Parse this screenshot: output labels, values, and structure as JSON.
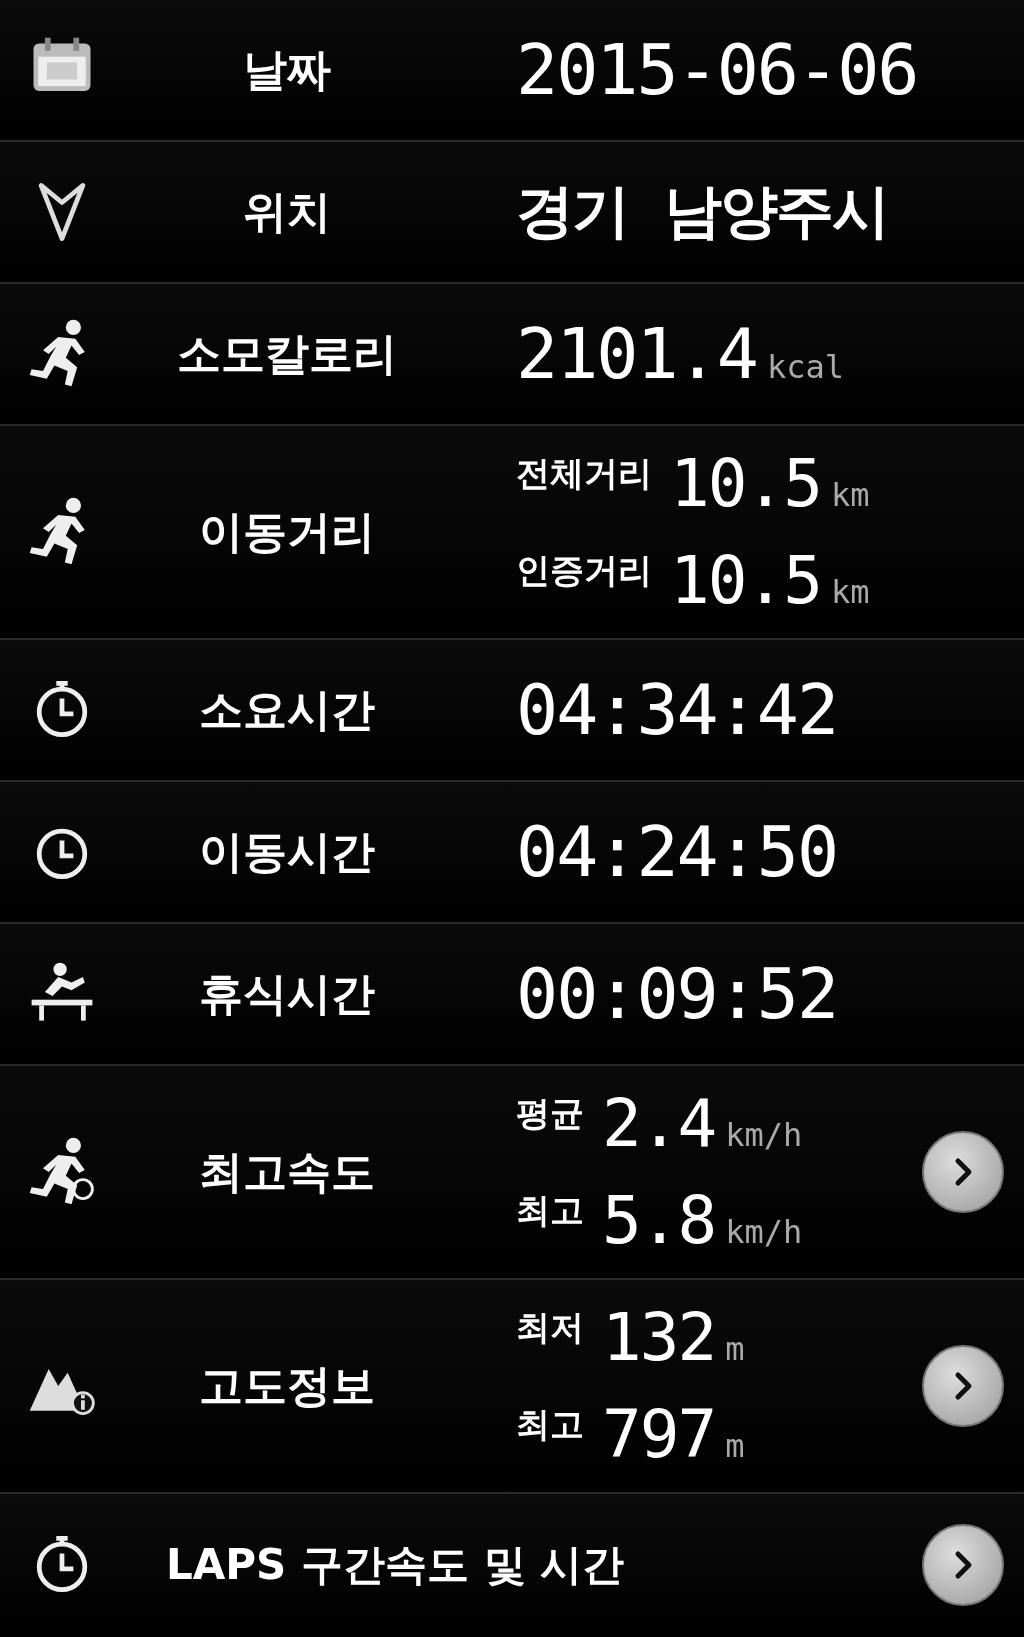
{
  "rows": [
    {
      "kind": "single",
      "label": "날짜",
      "value": "2015-06-06",
      "has_arrow": false
    },
    {
      "kind": "single",
      "label": "위치",
      "value": "경기  남양주시",
      "korean": true,
      "has_arrow": false
    },
    {
      "kind": "single",
      "label": "소모칼로리",
      "value": "2101.4",
      "unit": "kcal",
      "has_arrow": false
    },
    {
      "kind": "dual",
      "label": "이동거리",
      "lines": [
        {
          "caption": "전체거리",
          "value": "10.5",
          "unit": "km"
        },
        {
          "caption": "인증거리",
          "value": "10.5",
          "unit": "km"
        }
      ],
      "has_arrow": false
    },
    {
      "kind": "single",
      "label": "소요시간",
      "value": "04:34:42",
      "has_arrow": false
    },
    {
      "kind": "single",
      "label": "이동시간",
      "value": "04:24:50",
      "has_arrow": false
    },
    {
      "kind": "single",
      "label": "휴식시간",
      "value": "00:09:52",
      "has_arrow": false
    },
    {
      "kind": "dual",
      "label": "최고속도",
      "lines": [
        {
          "caption": "평균",
          "value": "2.4",
          "unit": "km/h"
        },
        {
          "caption": "최고",
          "value": "5.8",
          "unit": "km/h"
        }
      ],
      "has_arrow": true
    },
    {
      "kind": "dual",
      "label": "고도정보",
      "lines": [
        {
          "caption": "최저",
          "value": "132",
          "unit": "m"
        },
        {
          "caption": "최고",
          "value": "797",
          "unit": "m"
        }
      ],
      "has_arrow": true
    },
    {
      "kind": "link",
      "label": "LAPS 구간속도 및 시간",
      "has_arrow": true
    }
  ]
}
